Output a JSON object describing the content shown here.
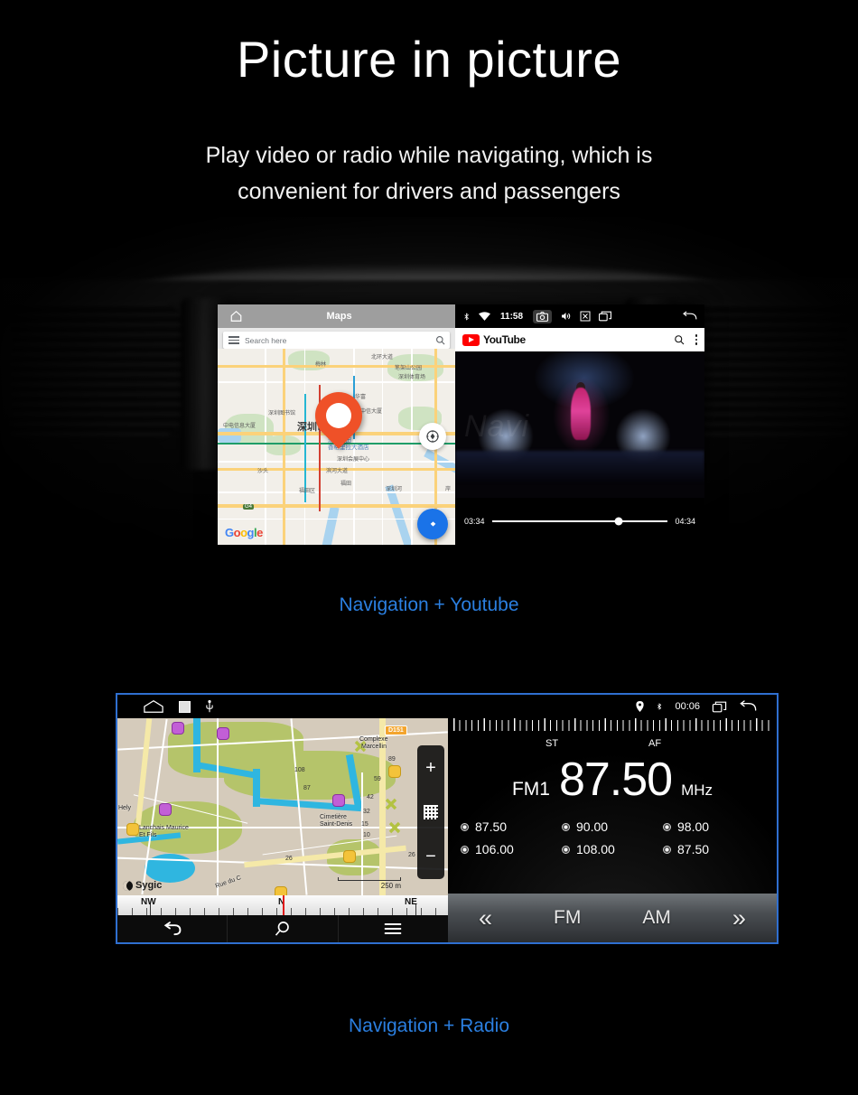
{
  "header": {
    "title": "Picture in picture",
    "subtitle_line1": "Play video or radio while navigating, which is",
    "subtitle_line2": "convenient for drivers and passengers",
    "accent_color": "#2b7fe0"
  },
  "screen1": {
    "caption": "Navigation + Youtube",
    "maps": {
      "home_icon": "home-icon",
      "title": "Maps",
      "menu_icon": "hamburger-icon",
      "search_placeholder": "Search here",
      "search_icon": "search-icon",
      "compass_icon": "compass-icon",
      "navigate_icon": "navigation-arrow-icon",
      "attribution": "Google",
      "labels": [
        "北环大道",
        "笔架山公园",
        "深圳体育场",
        "梅林",
        "华富",
        "深圳图书馆",
        "中信大厦",
        "中电信息大厦",
        "深圳市",
        "深圳福田",
        "香格里拉大酒店",
        "深圳会展中心",
        "滨河大道",
        "沙头",
        "福田区",
        "福田",
        "深圳河",
        "岸",
        "G4"
      ]
    },
    "statusbar": {
      "bluetooth_icon": "bluetooth-icon",
      "wifi_icon": "wifi-icon",
      "time": "11:58",
      "camera_icon": "camera-icon",
      "volume_icon": "volume-icon",
      "close_icon": "close-box-icon",
      "recents_icon": "recents-icon",
      "back_icon": "back-arrow-icon"
    },
    "youtube": {
      "logo_text": "YouTube",
      "search_icon": "search-icon",
      "overflow_icon": "more-vertical-icon",
      "watermark": "Navi",
      "current_time": "03:34",
      "total_time": "04:34",
      "progress_percent": 72
    }
  },
  "screen2": {
    "caption": "Navigation + Radio",
    "border_color": "#2f6fd0",
    "statusbar_left": {
      "home_icon": "home-outline-icon",
      "square_icon": "square-icon",
      "usb_icon": "usb-icon"
    },
    "statusbar_right": {
      "location_icon": "location-pin-icon",
      "bluetooth_icon": "bluetooth-icon",
      "time": "00:06",
      "recents_icon": "recents-icon",
      "back_icon": "back-arrow-icon"
    },
    "sygic": {
      "logo_text": "Sygic",
      "scale": "250 m",
      "zoom_in_icon": "plus-icon",
      "grid_icon": "grid-icon",
      "zoom_out_icon": "minus-icon",
      "map_labels": [
        "Complexe",
        "Marcellin",
        "Cimetière",
        "Saint-Denis",
        "Lanchais Maurice",
        "Et Fils",
        "Hely",
        "Rue du C",
        "D151"
      ],
      "house_numbers": [
        "89",
        "59",
        "42",
        "32",
        "15",
        "10",
        "108",
        "87",
        "26",
        "26"
      ],
      "compass": {
        "left_label": "NW",
        "center_label": "N",
        "right_label": "NE"
      },
      "navbar": {
        "back_icon": "back-arrow-icon",
        "search_icon": "search-icon",
        "menu_icon": "hamburger-menu-icon"
      }
    },
    "radio": {
      "scale_min": "87.50",
      "scale_max": "108.00",
      "st_label": "ST",
      "af_label": "AF",
      "band": "FM1",
      "frequency": "87.50",
      "unit": "MHz",
      "presets": [
        "87.50",
        "90.00",
        "98.00",
        "106.00",
        "108.00",
        "87.50"
      ],
      "controls": {
        "prev_label": "«",
        "fm_label": "FM",
        "am_label": "AM",
        "next_label": "»"
      }
    }
  }
}
